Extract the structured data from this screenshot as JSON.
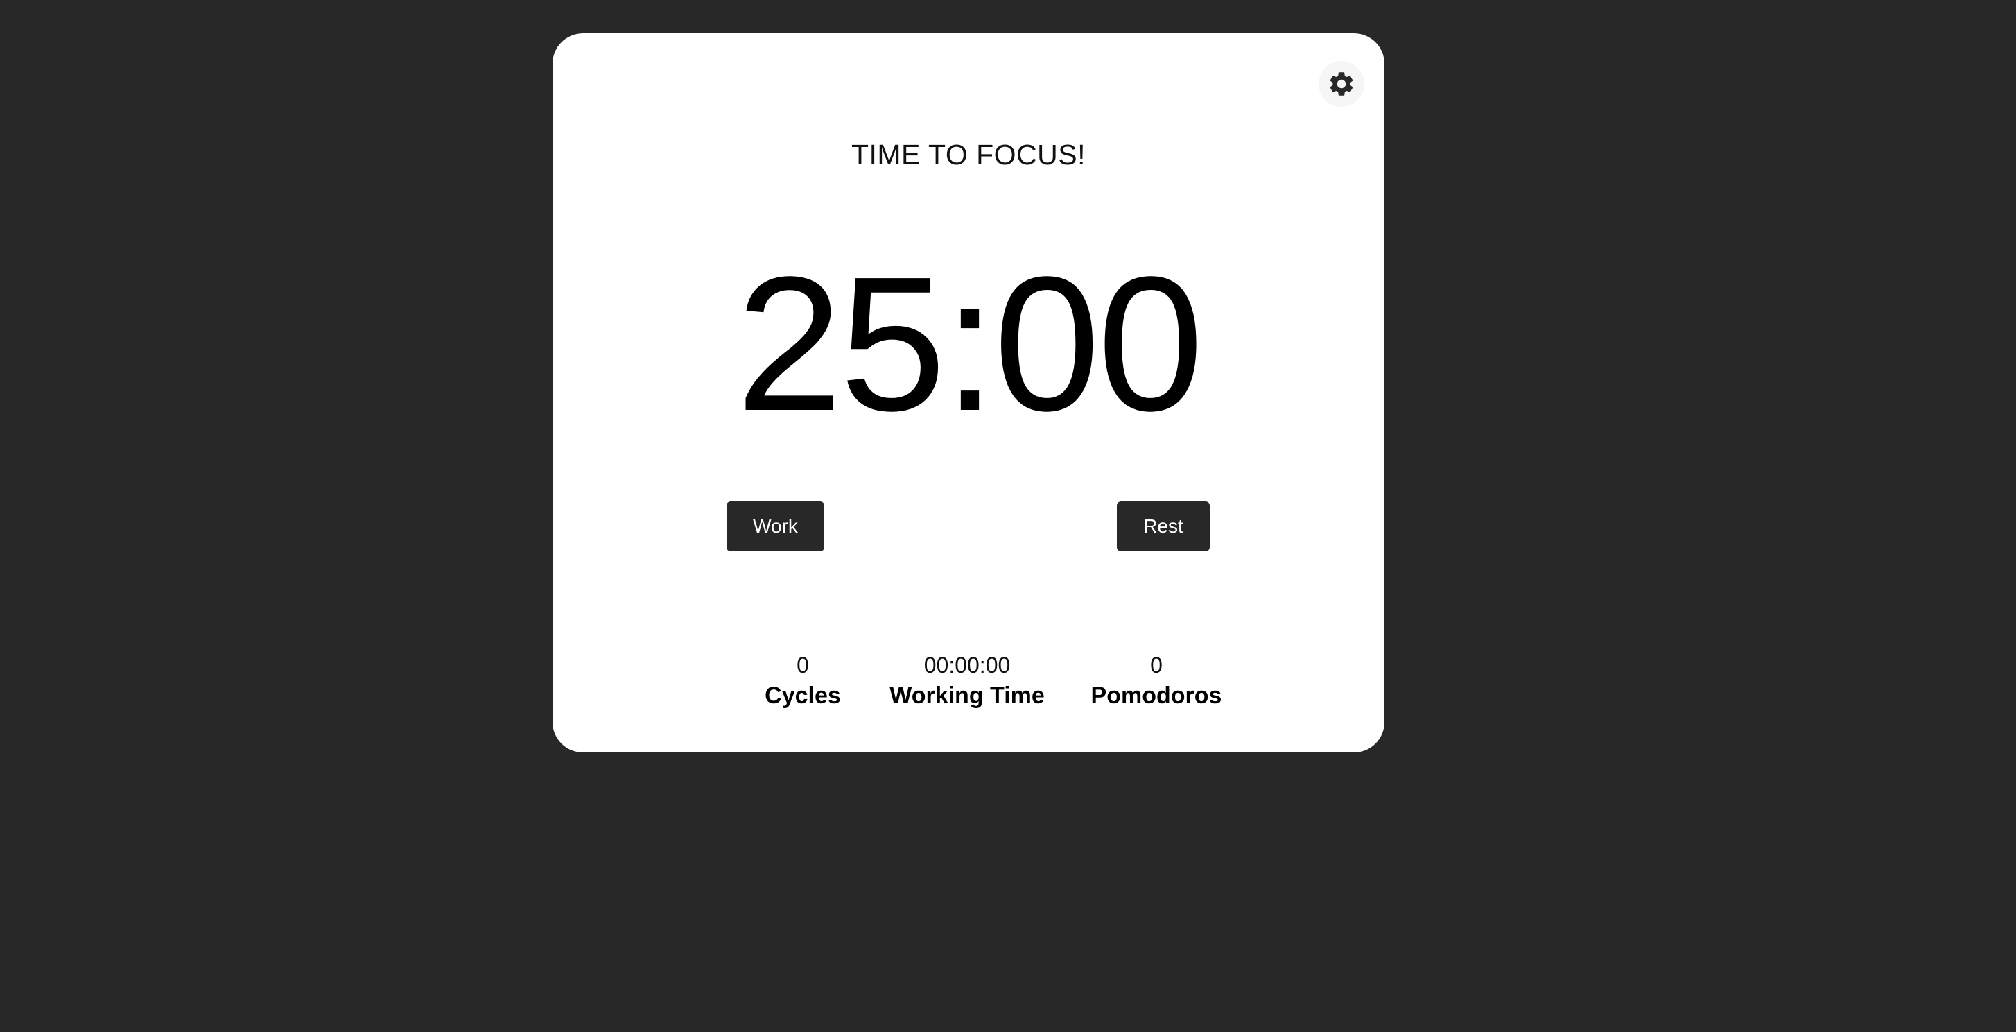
{
  "header": {
    "title": "TIME TO FOCUS!",
    "settings_icon": "gear-icon"
  },
  "timer": {
    "display": "25:00"
  },
  "controls": {
    "work_label": "Work",
    "rest_label": "Rest"
  },
  "stats": {
    "cycles": {
      "value": "0",
      "label": "Cycles"
    },
    "working_time": {
      "value": "00:00:00",
      "label": "Working Time"
    },
    "pomodoros": {
      "value": "0",
      "label": "Pomodoros"
    }
  },
  "colors": {
    "background": "#282828",
    "card": "#ffffff",
    "button": "#282828",
    "text": "#000000"
  }
}
